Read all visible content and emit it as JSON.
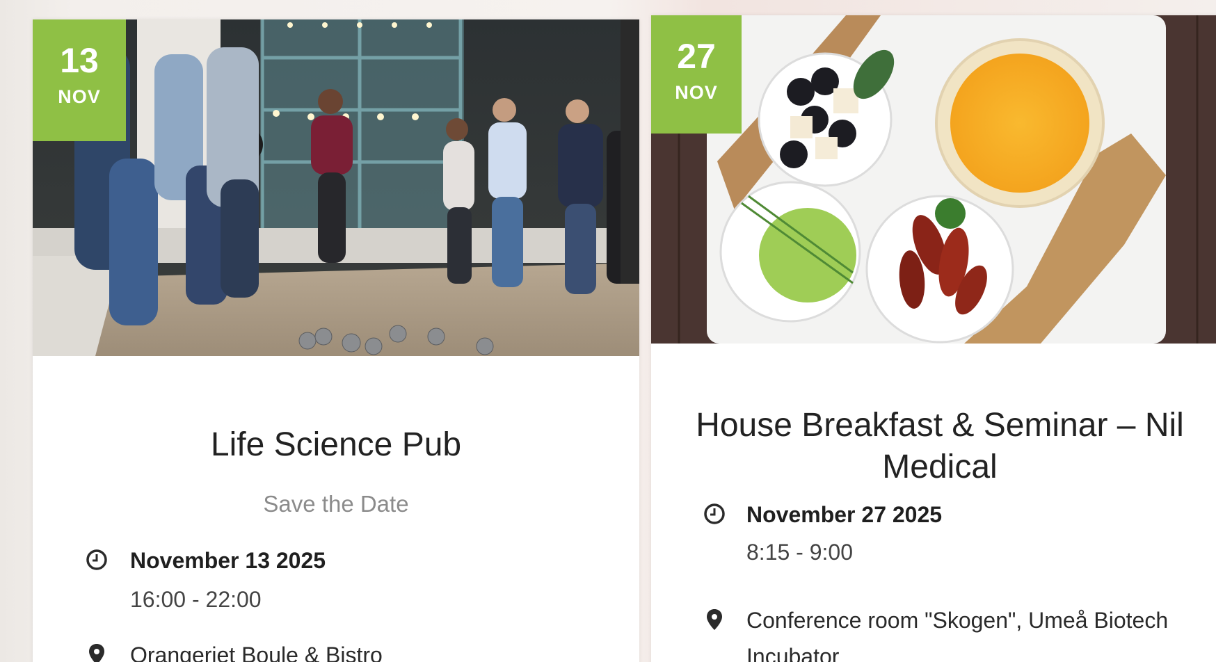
{
  "events": [
    {
      "day": "13",
      "month": "NOV",
      "title": "Life Science Pub",
      "subtitle": "Save the Date",
      "date": "November 13 2025",
      "time": "16:00 - 22:00",
      "location": "Orangeriet Boule & Bistro"
    },
    {
      "day": "27",
      "month": "NOV",
      "title": "House Breakfast & Seminar – Nil Medical",
      "date": "November 27 2025",
      "time": "8:15 - 9:00",
      "location": "Conference room \"Skogen\", Umeå Biotech Incubator"
    }
  ],
  "colors": {
    "badge": "#8fc045",
    "title": "#222222",
    "subtitle": "#8b8b8b"
  },
  "icons": {
    "time": "clock-icon",
    "location": "map-pin-icon"
  }
}
